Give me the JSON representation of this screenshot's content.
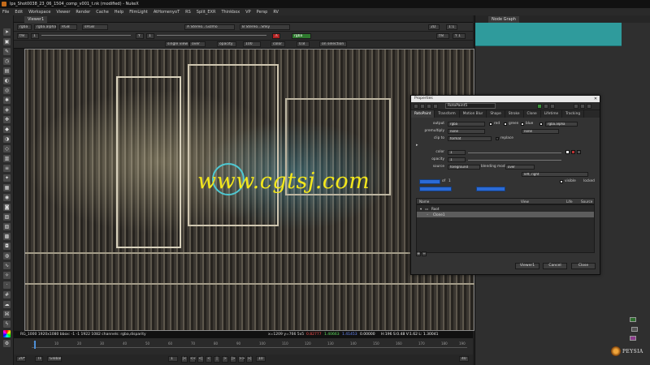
{
  "window": {
    "title": "lps_Shot0038_23_06_1504_comp_v001_t.nk (modified) - NukeX"
  },
  "menu": [
    "File",
    "Edit",
    "Workspace",
    "Viewer",
    "Render",
    "Cache",
    "Help",
    "FilmLight",
    "AtHomenyoT",
    "RS",
    "Split_EXR",
    "Thinkbox",
    "VP",
    "Persp",
    "RV"
  ],
  "viewer": {
    "tab": "Viewer1",
    "row1": [
      "rgba",
      "rgba.alpha",
      "RGB",
      "sRGB",
      "A  Stereo...Gizmo",
      "B  Stereo...Shky",
      "2D"
    ],
    "row1_right": [
      "1:1",
      "f/8",
      "Y 1"
    ],
    "row2": [
      "f/8",
      "1",
      "Y",
      "1",
      "rgba"
    ],
    "row3": [
      "single view",
      "over",
      "opacity",
      "100",
      "color",
      "0.8",
      "on selection"
    ],
    "info_left": "RG_1000 1920x1080  bbox: -1 -1 1922 1082 channels: rgba,disparity",
    "info_coords": "x=1209 y=766 5x5",
    "info_values": [
      "0.82777",
      "1.40663",
      "1.41453",
      "0.00000"
    ],
    "info_right": "H:196 S:0.48 V:1.62  L: 1.30041"
  },
  "timeline": {
    "ticks": [
      "1",
      "10",
      "20",
      "30",
      "40",
      "50",
      "60",
      "70",
      "80",
      "90",
      "100",
      "110",
      "120",
      "130",
      "140",
      "150",
      "160",
      "170",
      "180",
      "190"
    ],
    "fps": "20*",
    "tf": "TF",
    "global": "Global",
    "frame": "1",
    "step": "10",
    "end": "40",
    "transport": [
      "|<",
      "<<",
      "<|",
      "<",
      "|",
      ">",
      "|>",
      ">>",
      ">|"
    ]
  },
  "node_graph": {
    "tab": "Node Graph"
  },
  "logo_text": "PEYSIA",
  "properties": {
    "window_title": "Properties",
    "node_name": "RotoPaint5",
    "tabs": [
      "RotoPaint",
      "Transform",
      "Motion Blur",
      "Shape",
      "Stroke",
      "Clone",
      "Lifetime",
      "Tracking"
    ],
    "output_label": "output",
    "output_value": "rgba",
    "channels": [
      "red",
      "green",
      "blue"
    ],
    "alpha_value": "rgba.alpha",
    "premultiply_label": "premultiply",
    "premultiply_value": "none",
    "premultiply_value2": "none",
    "clipto_label": "clip to",
    "clipto_value": "format",
    "replace_label": "replace",
    "color_label": "color",
    "color_value": "1",
    "opacity_label": "opacity",
    "opacity_value": "1",
    "source_label": "source",
    "source_value": "foreground",
    "blending_label": "blending mode",
    "blending_value": "over",
    "eye_value": "left, right",
    "frame_label": "of",
    "frame_value": "1",
    "visible_label": "visible",
    "locked_label": "locked",
    "list_headers": [
      "Name",
      "View",
      "Life",
      "Source"
    ],
    "list_rows": [
      "Root",
      "Clone1"
    ],
    "buttons": [
      "Viewer1",
      "Cancel",
      "Close"
    ]
  },
  "watermark": "www.cgtsj.com"
}
